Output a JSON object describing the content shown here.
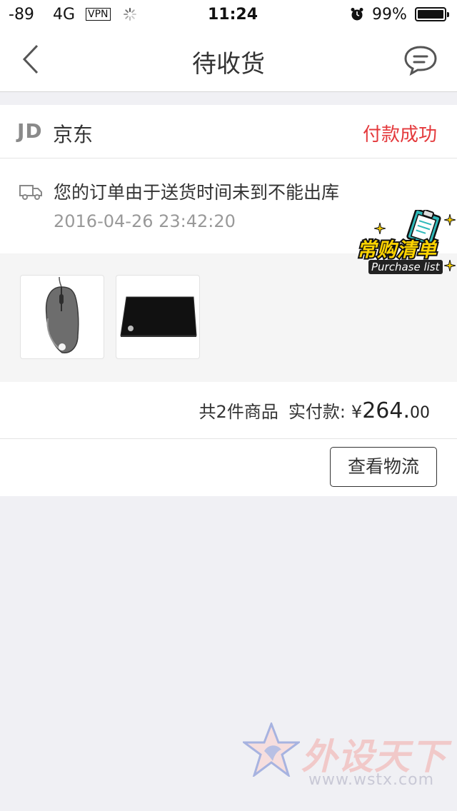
{
  "status_bar": {
    "signal": "-89",
    "network": "4G",
    "vpn": "VPN",
    "time": "11:24",
    "battery": "99%",
    "battery_level": 0.99
  },
  "header": {
    "title": "待收货",
    "back_icon": "chevron-left-icon",
    "message_icon": "chat-bubble-icon"
  },
  "shop": {
    "logo_text": "JD",
    "name": "京东",
    "status": "付款成功",
    "status_color": "#e4393c"
  },
  "tracking": {
    "icon": "truck-icon",
    "message": "您的订单由于送货时间未到不能出库",
    "time": "2016-04-26 23:42:20"
  },
  "products": [
    {
      "name_icon": "mouse-product-icon"
    },
    {
      "name_icon": "mousepad-product-icon"
    }
  ],
  "badge": {
    "main": "常购清单",
    "sub": "Purchase list"
  },
  "summary": {
    "count_text": "共2件商品",
    "pay_label": "实付款:",
    "currency": "¥",
    "amount_int": "264.",
    "amount_dec": "00"
  },
  "actions": {
    "logistics": "查看物流"
  },
  "watermark": {
    "title": "外设天下",
    "url": "www.wstx.com"
  }
}
